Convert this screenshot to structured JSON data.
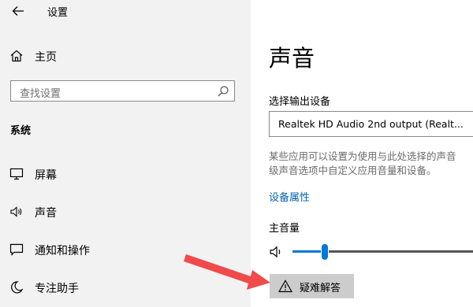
{
  "window": {
    "title": "设置"
  },
  "sidebar": {
    "home_label": "主页",
    "search": {
      "placeholder": "查找设置"
    },
    "section_title": "系统",
    "items": [
      {
        "label": "屏幕",
        "icon": "monitor-icon"
      },
      {
        "label": "声音",
        "icon": "speaker-icon"
      },
      {
        "label": "通知和操作",
        "icon": "notification-icon"
      },
      {
        "label": "专注助手",
        "icon": "moon-icon"
      }
    ]
  },
  "main": {
    "title": "声音",
    "output_label": "选择输出设备",
    "output_device": "Realtek HD Audio 2nd output (Realt...",
    "description_lines": [
      "某些应用可以设置为使用与此处选择的声音",
      "级声音选项中自定义应用音量和设备。"
    ],
    "device_properties_link": "设备属性",
    "master_volume_label": "主音量",
    "volume_fraction": 0.17,
    "troubleshoot_label": "疑难解答"
  },
  "colors": {
    "accent": "#0078d7",
    "link": "#0063b1",
    "sidebar_bg": "#f2f2f2",
    "annotation_arrow": "#f04a4a"
  }
}
